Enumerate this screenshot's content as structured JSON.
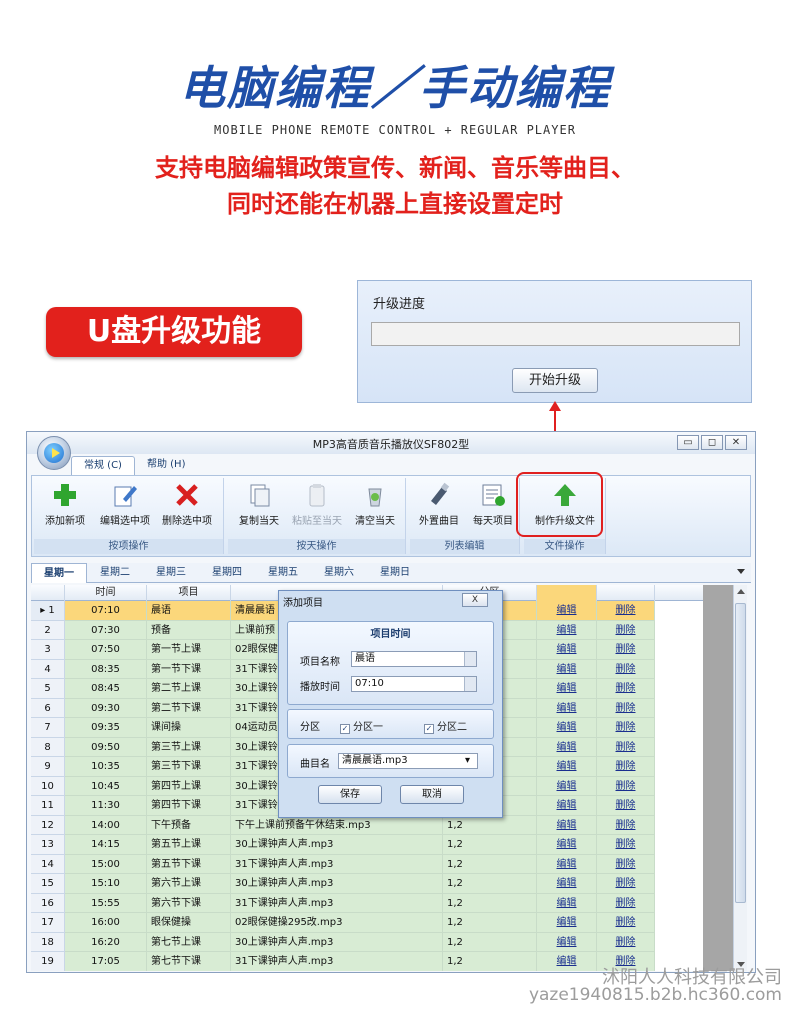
{
  "headline": "电脑编程／手动编程",
  "subline": "MOBILE PHONE REMOTE CONTROL + REGULAR PLAYER",
  "description": [
    "支持电脑编辑政策宣传、新闻、音乐等曲目、",
    "同时还能在机器上直接设置定时"
  ],
  "usb_badge": "U盘升级功能",
  "upgrade_panel": {
    "title": "升级进度",
    "progress": 0,
    "button": "开始升级"
  },
  "app": {
    "title": "MP3高音质音乐播放仪SF802型",
    "menu": [
      "常规 (C)",
      "帮助 (H)"
    ],
    "ribbon_groups": [
      {
        "label": "按项操作",
        "buttons": [
          {
            "label": "添加新项",
            "icon": "add-icon"
          },
          {
            "label": "编辑选中项",
            "icon": "edit-icon"
          },
          {
            "label": "删除选中项",
            "icon": "delete-icon"
          }
        ]
      },
      {
        "label": "按天操作",
        "buttons": [
          {
            "label": "复制当天",
            "icon": "copy-icon"
          },
          {
            "label": "粘贴至当天",
            "icon": "paste-icon"
          },
          {
            "label": "清空当天",
            "icon": "clear-icon"
          }
        ]
      },
      {
        "label": "列表编辑",
        "buttons": [
          {
            "label": "外置曲目",
            "icon": "usb-drive-icon"
          },
          {
            "label": "每天项目",
            "icon": "checklist-icon"
          }
        ]
      },
      {
        "label": "文件操作",
        "buttons": [
          {
            "label": "制作升级文件",
            "icon": "upload-arrow-icon"
          }
        ]
      }
    ],
    "day_tabs": [
      "星期一",
      "星期二",
      "星期三",
      "星期四",
      "星期五",
      "星期六",
      "星期日"
    ],
    "grid": {
      "headers": [
        "",
        "时间",
        "项目",
        "",
        "分区",
        "",
        ""
      ],
      "edit_label": "编辑",
      "delete_label": "删除",
      "rows": [
        [
          "1",
          "07:10",
          "晨语",
          "清晨晨语",
          "1,2"
        ],
        [
          "2",
          "07:30",
          "预备",
          "上课前预",
          "1,2"
        ],
        [
          "3",
          "07:50",
          "第一节上课",
          "02眼保健",
          "1,2"
        ],
        [
          "4",
          "08:35",
          "第一节下课",
          "31下课铃",
          "1,2"
        ],
        [
          "5",
          "08:45",
          "第二节上课",
          "30上课铃",
          "1,2"
        ],
        [
          "6",
          "09:30",
          "第二节下课",
          "31下课铃",
          "1,2"
        ],
        [
          "7",
          "09:35",
          "课间操",
          "04运动员",
          "1,2"
        ],
        [
          "8",
          "09:50",
          "第三节上课",
          "30上课铃",
          "1,2"
        ],
        [
          "9",
          "10:35",
          "第三节下课",
          "31下课铃",
          "1,2"
        ],
        [
          "10",
          "10:45",
          "第四节上课",
          "30上课铃",
          "1,2"
        ],
        [
          "11",
          "11:30",
          "第四节下课",
          "31下课铃",
          "1,2"
        ],
        [
          "12",
          "14:00",
          "下午预备",
          "下午上课前预备午休结束.mp3",
          "1,2"
        ],
        [
          "13",
          "14:15",
          "第五节上课",
          "30上课钟声人声.mp3",
          "1,2"
        ],
        [
          "14",
          "15:00",
          "第五节下课",
          "31下课钟声人声.mp3",
          "1,2"
        ],
        [
          "15",
          "15:10",
          "第六节上课",
          "30上课钟声人声.mp3",
          "1,2"
        ],
        [
          "16",
          "15:55",
          "第六节下课",
          "31下课钟声人声.mp3",
          "1,2"
        ],
        [
          "17",
          "16:00",
          "眼保健操",
          "02眼保健操295改.mp3",
          "1,2"
        ],
        [
          "18",
          "16:20",
          "第七节上课",
          "30上课钟声人声.mp3",
          "1,2"
        ],
        [
          "19",
          "17:05",
          "第七节下课",
          "31下课钟声人声.mp3",
          "1,2"
        ]
      ]
    },
    "dialog": {
      "title": "添加项目",
      "close": "X",
      "section_title": "项目时间",
      "name_label": "项目名称",
      "name_value": "晨语",
      "time_label": "播放时间",
      "time_value": "07:10",
      "zone_label": "分区",
      "zone_1": "分区一",
      "zone_2": "分区二",
      "track_label": "曲目名",
      "track_value": "清晨晨语.mp3",
      "save": "保存",
      "cancel": "取消"
    }
  },
  "watermark": {
    "company": "沭阳人人科技有限公司",
    "url": "yaze1940815.b2b.hc360.com"
  },
  "colors": {
    "headline": "#1f4fa8",
    "accent_red": "#e2211c",
    "row_green": "#d8ecd4",
    "row_selected": "#fbd77b"
  }
}
